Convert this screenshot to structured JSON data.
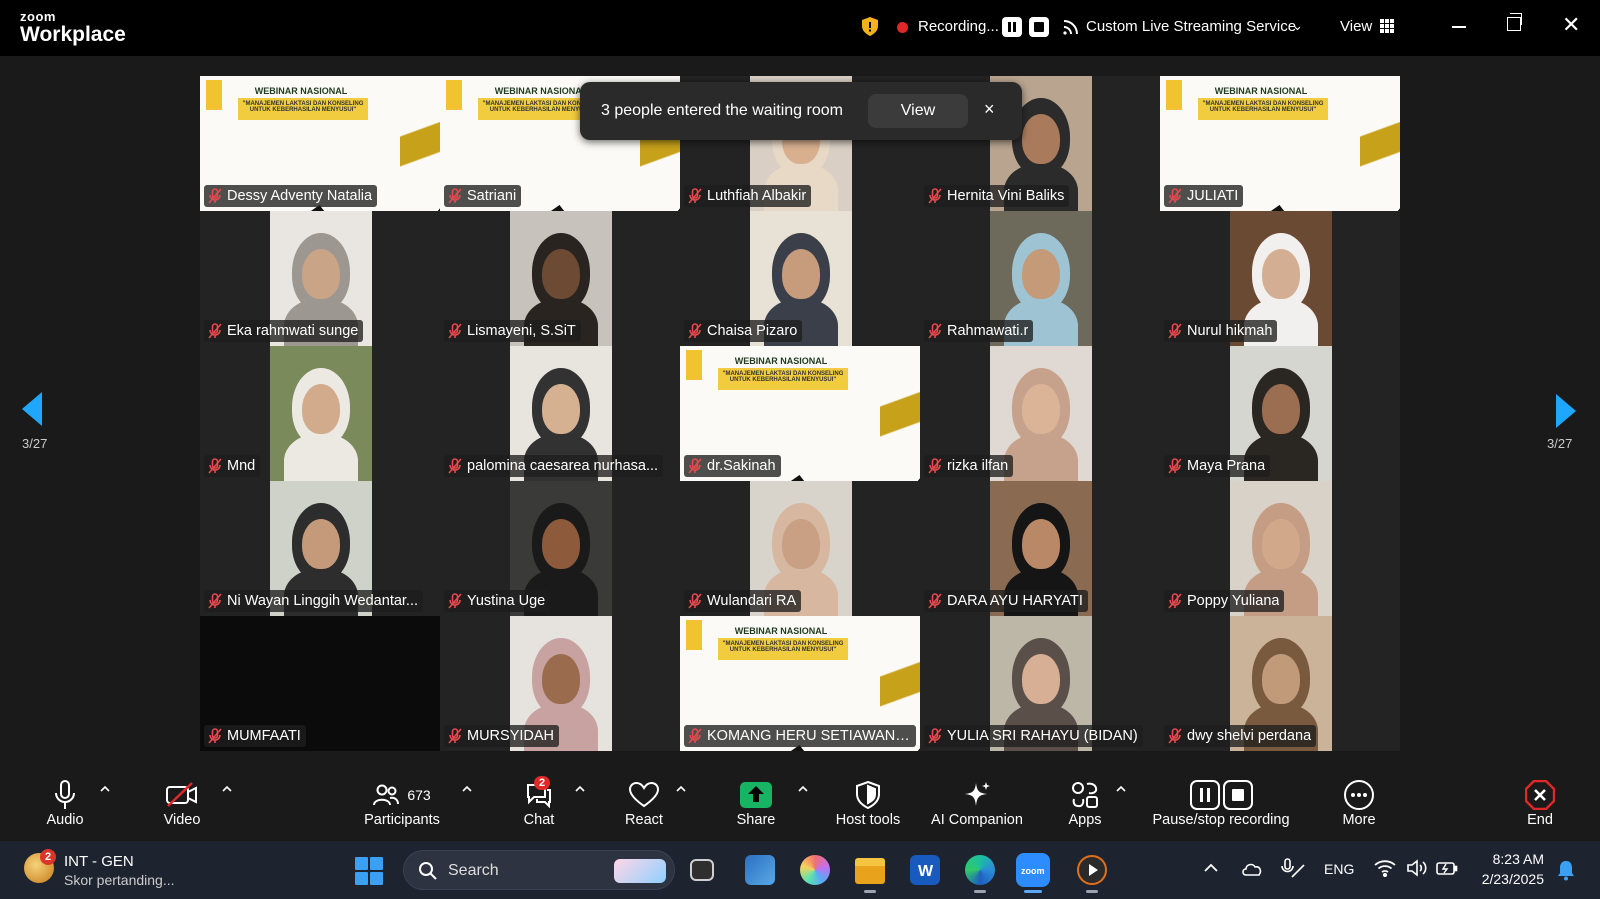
{
  "window": {
    "brand_small": "zoom",
    "brand_big": "Workplace",
    "recording_label": "Recording...",
    "streaming_label": "Custom Live Streaming Service",
    "view_label": "View"
  },
  "waiting_room": {
    "message": "3 people entered the waiting room",
    "view_button": "View",
    "close": "×"
  },
  "paging": {
    "left": "3/27",
    "right": "3/27"
  },
  "slide_text": {
    "title": "WEBINAR NASIONAL",
    "subtitle": "\"MANAJEMEN LAKTASI DAN KONSELING UNTUK KEBERHASILAN MENYUSUI\""
  },
  "participants": [
    {
      "name": "Dessy Adventy Natalia",
      "kind": "slide"
    },
    {
      "name": "Satriani",
      "kind": "slide"
    },
    {
      "name": "Luthfiah Albakir",
      "kind": "person",
      "bg": "#d9cfc4",
      "skin": "#d8b08f",
      "veil": "#e8d8c6"
    },
    {
      "name": "Hernita Vini Baliks",
      "kind": "person",
      "bg": "#b9a58f",
      "skin": "#a97b5c",
      "veil": "#2b2b2b"
    },
    {
      "name": "JULIATI",
      "kind": "slide"
    },
    {
      "name": "Eka rahmwati sunge",
      "kind": "person",
      "bg": "#e9e6e2",
      "skin": "#c9a487",
      "veil": "#9d9792"
    },
    {
      "name": "Lismayeni, S.SiT",
      "kind": "person",
      "bg": "#c7c3bc",
      "skin": "#6d4a33",
      "veil": "#2a2420"
    },
    {
      "name": "Chaisa Pizaro",
      "kind": "person",
      "bg": "#e8e2d6",
      "skin": "#c79c7d",
      "veil": "#3b3f49"
    },
    {
      "name": "Rahmawati.r",
      "kind": "person",
      "bg": "#6d6a5b",
      "skin": "#c49a78",
      "veil": "#9ec4d4"
    },
    {
      "name": "Nurul hikmah",
      "kind": "person",
      "bg": "#6b4a33",
      "skin": "#d3ae92",
      "veil": "#f2f0ee"
    },
    {
      "name": "Mnd",
      "kind": "person",
      "bg": "#7a8a5a",
      "skin": "#d2ab8d",
      "veil": "#ece9e2"
    },
    {
      "name": "palomina caesarea nurhasa...",
      "kind": "person",
      "bg": "#e8e4de",
      "skin": "#d5b192",
      "veil": "#323232"
    },
    {
      "name": "dr.Sakinah",
      "kind": "slide"
    },
    {
      "name": "rizka ilfan",
      "kind": "person",
      "bg": "#e0d9d3",
      "skin": "#dbb397",
      "veil": "#c6a28c"
    },
    {
      "name": "Maya Prana",
      "kind": "person",
      "bg": "#d6d6d0",
      "skin": "#9b6e52",
      "veil": "#2a2622"
    },
    {
      "name": "Ni Wayan Linggih Wedantar...",
      "kind": "person",
      "bg": "#cfd2c8",
      "skin": "#c59a7a",
      "veil": "#2d2d2d"
    },
    {
      "name": "Yustina Uge",
      "kind": "person",
      "bg": "#3a3a38",
      "skin": "#8e5a3c",
      "veil": "#1a1a1a"
    },
    {
      "name": "Wulandari RA",
      "kind": "person",
      "bg": "#d9d4cb",
      "skin": "#caa084",
      "veil": "#d7b79f"
    },
    {
      "name": "DARA AYU HARYATI",
      "kind": "person",
      "bg": "#8a6b52",
      "skin": "#b98866",
      "veil": "#151515"
    },
    {
      "name": "Poppy Yuliana",
      "kind": "person",
      "bg": "#d8d2c8",
      "skin": "#d1a98a",
      "veil": "#c59c84"
    },
    {
      "name": "MUMFAATI",
      "kind": "dark"
    },
    {
      "name": "MURSYIDAH",
      "kind": "person",
      "bg": "#e6e3df",
      "skin": "#9a6b4c",
      "veil": "#c7a2a0"
    },
    {
      "name": "KOMANG HERU SETIAWAN ...",
      "kind": "slide"
    },
    {
      "name": "YULIA SRI RAHAYU (BIDAN)",
      "kind": "person",
      "bg": "#bdb7a8",
      "skin": "#d7af95",
      "veil": "#5b4f4a"
    },
    {
      "name": "dwy shelvi perdana",
      "kind": "person",
      "bg": "#cbb39a",
      "skin": "#c19a7a",
      "veil": "#7a5a3e"
    }
  ],
  "toolbar": {
    "audio": "Audio",
    "video": "Video",
    "participants": "Participants",
    "participants_count": "673",
    "chat": "Chat",
    "chat_badge": "2",
    "react": "React",
    "share": "Share",
    "host_tools": "Host tools",
    "ai_companion": "AI Companion",
    "apps": "Apps",
    "pause_stop_recording": "Pause/stop recording",
    "more": "More",
    "end": "End"
  },
  "taskbar": {
    "widget_badge": "2",
    "widget_title": "INT - GEN",
    "widget_sub": "Skor pertanding...",
    "search_placeholder": "Search",
    "language": "ENG",
    "time": "8:23 AM",
    "date": "2/23/2025"
  },
  "colors": {
    "accent_blue": "#1ea7fd",
    "record_red": "#e02828",
    "share_green": "#16b463",
    "slide_gold": "#c8a11b"
  }
}
